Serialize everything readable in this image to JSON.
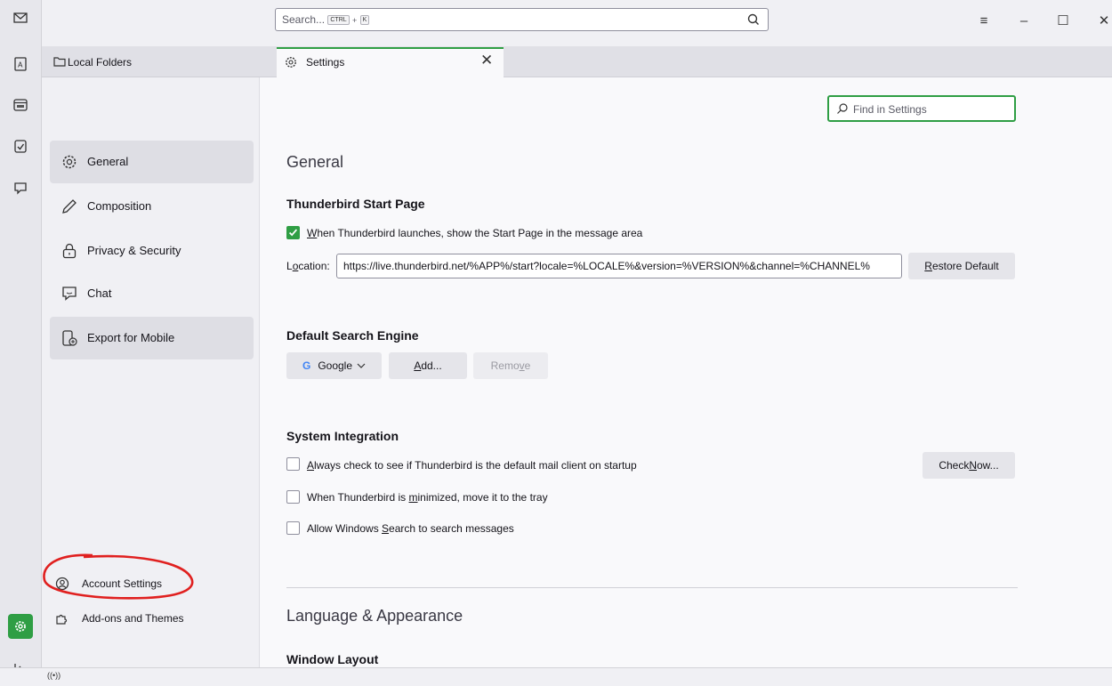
{
  "search": {
    "placeholder": "Search...",
    "key1": "CTRL",
    "plus": "+",
    "key2": "K"
  },
  "folder_pane": {
    "title": "Local Folders"
  },
  "tab": {
    "label": "Settings"
  },
  "find": {
    "placeholder": "Find in Settings"
  },
  "nav": {
    "items": [
      {
        "label": "General"
      },
      {
        "label": "Composition"
      },
      {
        "label": "Privacy & Security"
      },
      {
        "label": "Chat"
      },
      {
        "label": "Export for Mobile"
      }
    ],
    "footer": [
      {
        "label": "Account Settings"
      },
      {
        "label": "Add-ons and Themes"
      }
    ]
  },
  "content": {
    "section_general": "General",
    "start_page": {
      "heading": "Thunderbird Start Page",
      "checkbox_label_u": "W",
      "checkbox_label_rest": "hen Thunderbird launches, show the Start Page in the message area",
      "checked": true,
      "location_label_pre": "L",
      "location_label_u": "o",
      "location_label_post": "cation:",
      "location_value": "https://live.thunderbird.net/%APP%/start?locale=%LOCALE%&version=%VERSION%&channel=%CHANNEL%",
      "restore_pre": "",
      "restore_u": "R",
      "restore_post": "estore Default"
    },
    "search_engine": {
      "heading": "Default Search Engine",
      "selected": "Google",
      "add_u": "A",
      "add_post": "dd...",
      "remove_pre": "Remo",
      "remove_u": "v",
      "remove_post": "e"
    },
    "system": {
      "heading": "System Integration",
      "opt1_u": "A",
      "opt1_rest": "lways check to see if Thunderbird is the default mail client on startup",
      "opt2_pre": "When Thunderbird is ",
      "opt2_u": "m",
      "opt2_post": "inimized, move it to the tray",
      "opt3_pre": "Allow Windows ",
      "opt3_u": "S",
      "opt3_post": "earch to search messages",
      "check_now_pre": "Check ",
      "check_now_u": "N",
      "check_now_post": "ow..."
    },
    "section_language": "Language & Appearance",
    "window_layout": "Window Layout"
  },
  "colors": {
    "accent": "#2f9e44",
    "annotation": "#e0201f"
  }
}
